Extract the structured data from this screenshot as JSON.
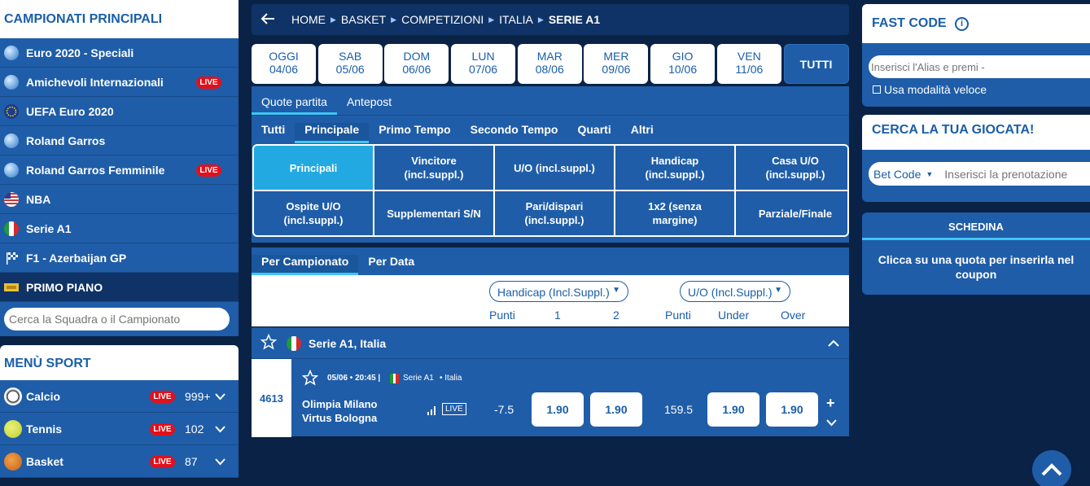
{
  "left": {
    "title": "CAMPIONATI PRINCIPALI",
    "items": [
      {
        "label": "Euro 2020 - Speciali",
        "icon": "globe-icon",
        "live": false
      },
      {
        "label": "Amichevoli Internazionali",
        "icon": "globe-icon",
        "live": true
      },
      {
        "label": "UEFA Euro 2020",
        "icon": "eu-flag-icon",
        "live": false
      },
      {
        "label": "Roland Garros",
        "icon": "globe-icon",
        "live": false
      },
      {
        "label": "Roland Garros Femminile",
        "icon": "globe-icon",
        "live": true
      },
      {
        "label": "NBA",
        "icon": "us-flag-icon",
        "live": false
      },
      {
        "label": "Serie A1",
        "icon": "italy-flag-icon",
        "live": false
      },
      {
        "label": "F1 - Azerbaijan GP",
        "icon": "checkered-flag-icon",
        "live": false
      }
    ],
    "live_label": "LIVE",
    "primo_piano": "PRIMO PIANO",
    "search_placeholder": "Cerca la Squadra o il Campionato",
    "menu_title": "MENÙ SPORT",
    "sports": [
      {
        "label": "Calcio",
        "count": "999+",
        "icon": "soccer-ball-icon"
      },
      {
        "label": "Tennis",
        "count": "102",
        "icon": "tennis-ball-icon"
      },
      {
        "label": "Basket",
        "count": "87",
        "icon": "basketball-icon"
      }
    ]
  },
  "breadcrumb": [
    "HOME",
    "BASKET",
    "COMPETIZIONI",
    "ITALIA",
    "SERIE A1"
  ],
  "days": [
    {
      "name": "OGGI",
      "date": "04/06"
    },
    {
      "name": "SAB",
      "date": "05/06"
    },
    {
      "name": "DOM",
      "date": "06/06"
    },
    {
      "name": "LUN",
      "date": "07/06"
    },
    {
      "name": "MAR",
      "date": "08/06"
    },
    {
      "name": "MER",
      "date": "09/06"
    },
    {
      "name": "GIO",
      "date": "10/06"
    },
    {
      "name": "VEN",
      "date": "11/06"
    }
  ],
  "days_all": "TUTTI",
  "tabs_main": [
    "Quote partita",
    "Antepost"
  ],
  "tabs_sub": [
    "Tutti",
    "Principale",
    "Primo Tempo",
    "Secondo Tempo",
    "Quarti",
    "Altri"
  ],
  "markets": [
    "Principali",
    "Vincitore\n(incl.suppl.)",
    "U/O (incl.suppl.)",
    "Handicap\n(incl.suppl.)",
    "Casa U/O\n(incl.suppl.)",
    "Ospite U/O\n(incl.suppl.)",
    "Supplementari S/N",
    "Pari/dispari\n(incl.suppl.)",
    "1x2 (senza\nmargine)",
    "Parziale/Finale"
  ],
  "tabs_view": [
    "Per Campionato",
    "Per Data"
  ],
  "selectors": {
    "handicap": "Handicap (Incl.Suppl.)",
    "uo": "U/O (Incl.Suppl.)"
  },
  "columns": {
    "punti1": "Punti",
    "c1": "1",
    "c2": "2",
    "punti2": "Punti",
    "under": "Under",
    "over": "Over"
  },
  "league": "Serie A1, Italia",
  "event": {
    "id": "4613",
    "datetime": "05/06 • 20:45 |",
    "competition": "Serie A1",
    "country": "• Italia",
    "home": "Olimpia Milano",
    "away": "Virtus Bologna",
    "live_tag": "LIVE",
    "handicap": "-7.5",
    "odd1": "1.90",
    "odd2": "1.90",
    "uo_line": "159.5",
    "under": "1.90",
    "over": "1.90"
  },
  "right": {
    "fast_code_title": "FAST CODE",
    "fast_code_placeholder": "Inserisci l'Alias e premi -",
    "fast_mode": "Usa modalità veloce",
    "cerca_title": "CERCA LA TUA GIOCATA!",
    "bet_code": "Bet Code",
    "bet_placeholder": "Inserisci la prenotazione",
    "schedina_title": "SCHEDINA",
    "schedina_text": "Clicca su una quota per inserirla nel coupon"
  }
}
